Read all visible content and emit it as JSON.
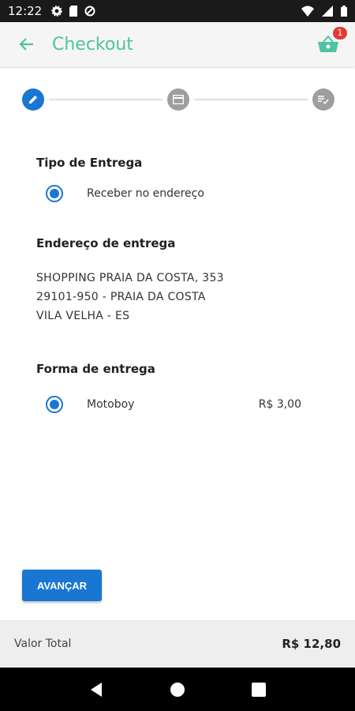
{
  "status_bar": {
    "time": "12:22",
    "icons": [
      "gear-icon",
      "sd-card-icon",
      "sync-icon",
      "wifi-icon",
      "signal-icon",
      "battery-icon"
    ]
  },
  "app_bar": {
    "title": "Checkout",
    "cart_count": "1",
    "accent_color": "#4fc3a1"
  },
  "stepper": {
    "steps": [
      "edit-icon",
      "card-icon",
      "checklist-icon"
    ],
    "active_step": 1
  },
  "delivery_type": {
    "title": "Tipo de Entrega",
    "option_label": "Receber no endereço"
  },
  "address": {
    "title": "Endereço de entrega",
    "line1": "SHOPPING PRAIA DA COSTA, 353",
    "line2": "29101-950 - PRAIA DA COSTA",
    "line3": "VILA VELHA - ES"
  },
  "delivery_method": {
    "title": "Forma de entrega",
    "option_label": "Motoboy",
    "option_price": "R$ 3,00"
  },
  "actions": {
    "advance_label": "AVANÇAR"
  },
  "total": {
    "label": "Valor Total",
    "value": "R$ 12,80"
  },
  "colors": {
    "primary": "#1976d2",
    "badge": "#e53935"
  }
}
